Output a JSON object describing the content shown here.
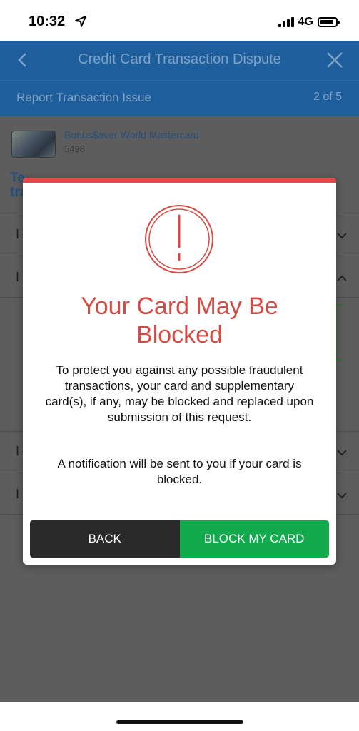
{
  "status_bar": {
    "time": "10:32",
    "network": "4G",
    "icons": [
      "location-arrow-icon",
      "signal-bars-icon",
      "battery-icon"
    ]
  },
  "header": {
    "title": "Credit Card Transaction Dispute",
    "back_icon": "chevron-left-icon",
    "close_icon": "close-icon"
  },
  "sub_header": {
    "title": "Report Transaction Issue",
    "step": "2 of 5"
  },
  "card": {
    "name": "Bonus$aver World Mastercard",
    "number": "5498"
  },
  "background": {
    "heading_partial": "Te",
    "heading_line2": "tra",
    "row_marks": [
      "I",
      "I",
      "I",
      "I"
    ]
  },
  "modal": {
    "icon": "alert-exclamation-icon",
    "title": "Your Card May Be Blocked",
    "body": "To protect you against any possible fraudulent transactions, your card and supplementary card(s), if any, may be blocked and replaced upon submission of this request.",
    "note": "A notification will be sent to you if your card is blocked.",
    "buttons": {
      "back": "BACK",
      "block": "BLOCK MY CARD"
    }
  },
  "colors": {
    "accent_red": "#e14a4a",
    "title_red": "#d64c45",
    "header_blue": "#1f5e9c",
    "back_button": "#2a2a2a",
    "block_button": "#11aa4c",
    "overlay": "#5d5d5d"
  }
}
